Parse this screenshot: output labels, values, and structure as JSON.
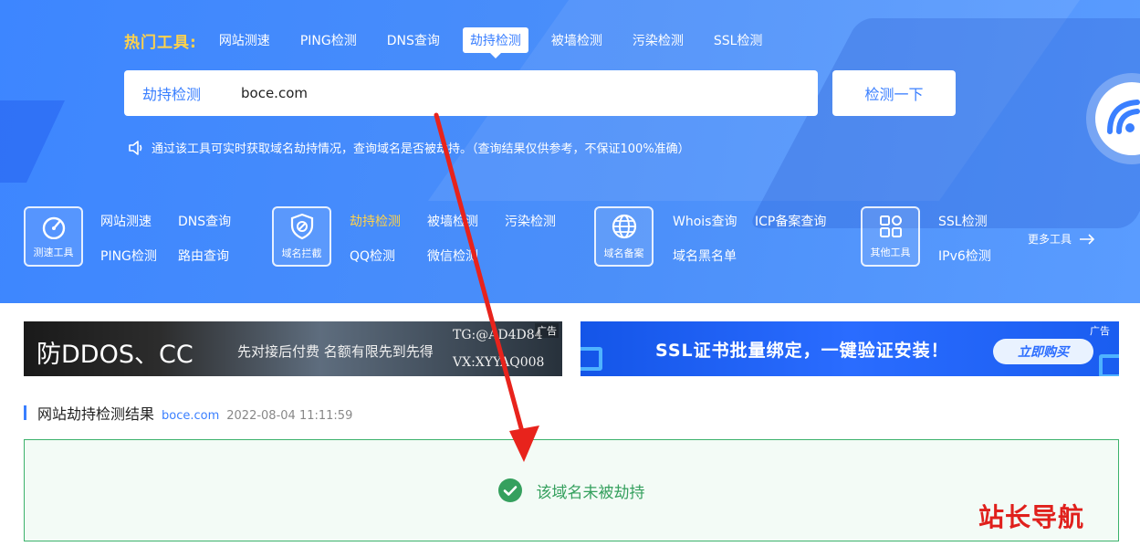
{
  "hot": {
    "label": "热门工具:",
    "items": [
      "网站测速",
      "PING检测",
      "DNS查询",
      "劫持检测",
      "被墙检测",
      "污染检测",
      "SSL检测"
    ]
  },
  "search": {
    "type": "劫持检测",
    "value": "boce.com",
    "button": "检测一下"
  },
  "notice": "通过该工具可实时获取域名劫持情况，查询域名是否被劫持。（查询结果仅供参考，不保证100%准确）",
  "categories": [
    {
      "label": "测速工具",
      "icon": "speedometer-icon",
      "links": [
        "网站测速",
        "DNS查询",
        "PING检测",
        "路由查询"
      ]
    },
    {
      "label": "域名拦截",
      "icon": "shield-icon",
      "links": [
        "劫持检测",
        "被墙检测",
        "污染检测",
        "QQ检测",
        "微信检测"
      ]
    },
    {
      "label": "域名备案",
      "icon": "globe-icon",
      "links": [
        "Whois查询",
        "ICP备案查询",
        "域名黑名单"
      ]
    },
    {
      "label": "其他工具",
      "icon": "grid-icon",
      "links": [
        "SSL检测",
        "IPv6检测"
      ]
    }
  ],
  "more": "更多工具",
  "ads": {
    "ad1": {
      "main": "防DDOS、CC",
      "sub": "先对接后付费 名额有限先到先得",
      "tg": "TG:@AD4D84",
      "vx": "VX:XYYAQ008",
      "tag": "广告"
    },
    "ad2": {
      "main": "SSL证书批量绑定，一键验证安装！",
      "button": "立即购买",
      "tag": "广告"
    }
  },
  "result": {
    "title": "网站劫持检测结果",
    "domain": "boce.com",
    "time": "2022-08-04 11:11:59",
    "message": "该域名未被劫持"
  },
  "watermark": "站长导航",
  "colors": {
    "accent": "#3a7fff",
    "hero": "#4b8ff9",
    "highlight": "#ffd24a",
    "success": "#35a05e",
    "annotation": "#e0201c"
  }
}
